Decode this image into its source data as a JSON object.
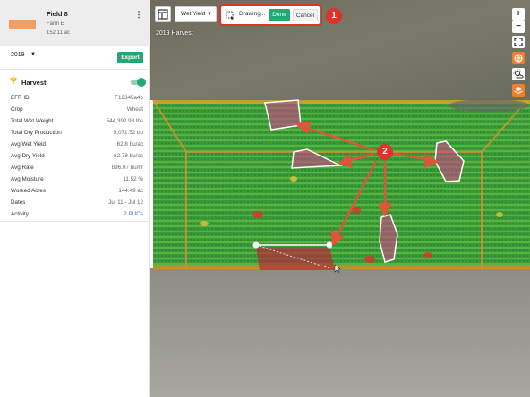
{
  "field": {
    "name": "Field 8",
    "farm": "Farm E",
    "acres": "152.11 ac",
    "thumb_color": "#f0a063",
    "menu_icon": "more-vertical-icon"
  },
  "year_select": {
    "value": "2019"
  },
  "export_label": "Export",
  "harvest": {
    "title": "Harvest",
    "toggle_on": true,
    "icon": "wheat-icon",
    "rows": [
      {
        "label": "EFR ID",
        "value": "F12345a4b"
      },
      {
        "label": "Crop",
        "value": "Wheat"
      },
      {
        "label": "Total Wet Weight",
        "value": "544,392.98 lbs"
      },
      {
        "label": "Total Dry Production",
        "value": "9,071.52 bu"
      },
      {
        "label": "Avg Wet Yield",
        "value": "62.8 bu/ac"
      },
      {
        "label": "Avg Dry Yield",
        "value": "62.78 bu/ac"
      },
      {
        "label": "Avg Rate",
        "value": "896.07 bu/hr"
      },
      {
        "label": "Avg Moisture",
        "value": "11.52 %"
      },
      {
        "label": "Worked Acres",
        "value": "144.49 ac"
      },
      {
        "label": "Dates",
        "value": "Jul 11 - Jul 12"
      },
      {
        "label": "Activity",
        "value": "2 PUCs"
      }
    ]
  },
  "map": {
    "layer_label": "2019 Harvest",
    "layer_select": "Wet Yield",
    "drawing_label": "Drawing...",
    "done_label": "Done",
    "cancel_label": "Cancel",
    "annotation_1": "1",
    "annotation_2": "2",
    "zoom_in": "+",
    "zoom_out": "−",
    "controls": [
      "zoom-in-icon",
      "zoom-out-icon",
      "fullscreen-icon",
      "globe-icon",
      "weather-icon",
      "layers-icon"
    ],
    "accent_color": "#27a673",
    "highlight_color": "#e0322b"
  }
}
